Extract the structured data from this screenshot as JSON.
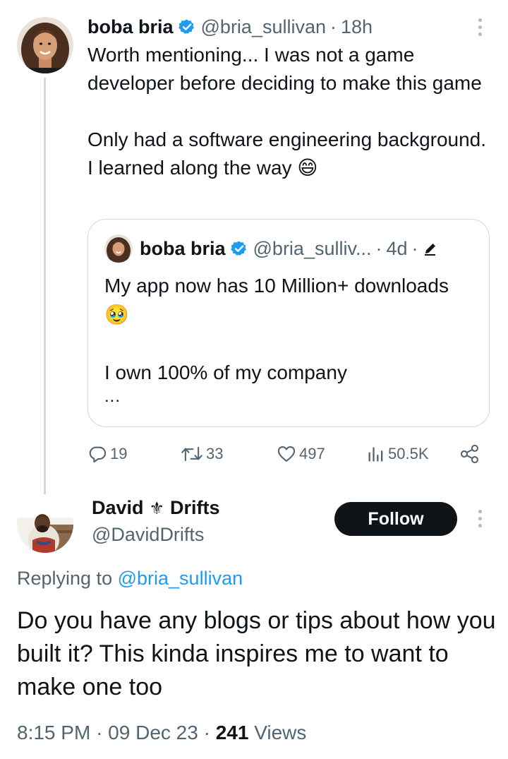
{
  "tweet": {
    "author_name": "boba bria",
    "author_handle": "@bria_sullivan",
    "time": "18h",
    "text_p1": "Worth mentioning... I was not a game developer before deciding to make this game",
    "text_p2": "Only had a software engineering background. I learned along the way 😄"
  },
  "quoted": {
    "author_name": "boba bria",
    "author_handle": "@bria_sulliv...",
    "time": "4d",
    "text_p1": "My app now has 10 Million+ downloads 🥹",
    "text_p2": "I own 100% of my company",
    "ellipsis": "..."
  },
  "actions": {
    "replies": "19",
    "retweets": "33",
    "likes": "497",
    "views": "50.5K"
  },
  "reply": {
    "author_name_part1": "David",
    "author_name_symbol": "⚜",
    "author_name_part2": "Drifts",
    "author_handle": "@DavidDrifts",
    "follow_label": "Follow",
    "replying_prefix": "Replying to",
    "replying_handle": "@bria_sullivan",
    "text": "Do you have any blogs or tips about how you built it? This kinda inspires me to want to make one too",
    "time": "8:15 PM",
    "date": "09 Dec 23",
    "views_count": "241",
    "views_label": "Views"
  },
  "colors": {
    "verified": "#1d9bf0",
    "link": "#1d9bf0",
    "secondary_text": "#536471",
    "follow_button": "#0f1419"
  },
  "icons": [
    "verified-badge-icon",
    "more-options-icon",
    "edit-pencil-icon",
    "reply-icon",
    "retweet-icon",
    "like-icon",
    "views-icon",
    "share-icon"
  ]
}
